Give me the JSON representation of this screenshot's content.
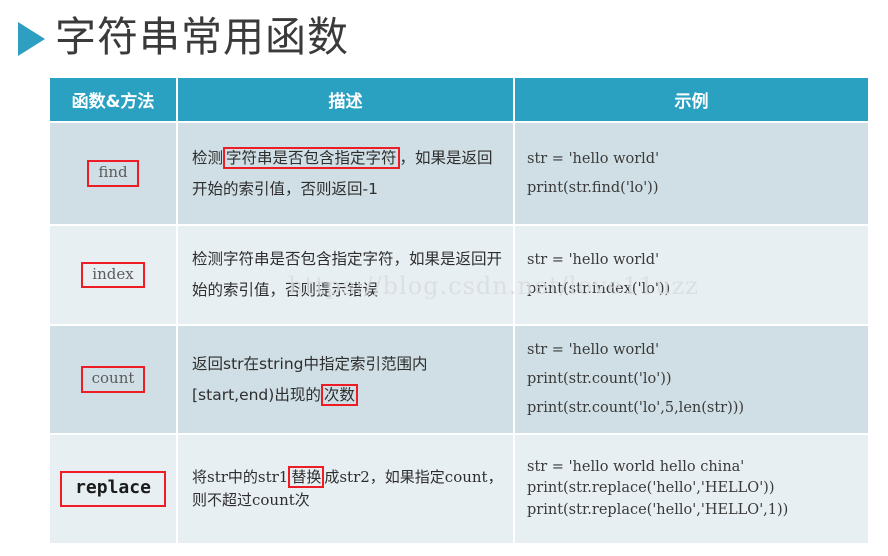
{
  "slide": {
    "title": "字符串常用函数",
    "bullet_icon": "play-triangle-icon",
    "accent_color": "#2BA1C2",
    "highlight_color": "#EE1C24"
  },
  "watermark": {
    "text": "https://blog.csdn.net/love11uzz"
  },
  "table": {
    "headers": [
      "函数&方法",
      "描述",
      "示例"
    ],
    "rows": [
      {
        "function": "find",
        "description_parts": [
          {
            "text": "检测",
            "highlight": false
          },
          {
            "text": "字符串是否包含指定字符",
            "highlight": true
          },
          {
            "text": "，如果是返回开始的索引值，否则返回-1",
            "highlight": false
          }
        ],
        "example_lines": [
          "str = 'hello world'",
          "print(str.find('lo'))"
        ]
      },
      {
        "function": "index",
        "description_parts": [
          {
            "text": "检测字符串是否包含指定字符，如果是返回开始的索引值，否则提示错误",
            "highlight": false
          }
        ],
        "example_lines": [
          "str = 'hello world'",
          "print(str.index('lo'))"
        ]
      },
      {
        "function": "count",
        "description_parts": [
          {
            "text": "返回str在string中指定索引范围内[start,end)出现的",
            "highlight": false
          },
          {
            "text": "次数",
            "highlight": true
          }
        ],
        "example_lines": [
          "str = 'hello world'",
          "print(str.count('lo'))",
          "print(str.count('lo',5,len(str)))"
        ]
      },
      {
        "function": "replace",
        "description_parts": [
          {
            "text": "将str中的str1",
            "highlight": false
          },
          {
            "text": "替换",
            "highlight": true
          },
          {
            "text": "成str2，如果指定count，则不超过count次",
            "highlight": false
          }
        ],
        "example_lines": [
          "str = 'hello world hello china'",
          "print(str.replace('hello','HELLO'))",
          "print(str.replace('hello','HELLO',1))"
        ]
      }
    ]
  }
}
